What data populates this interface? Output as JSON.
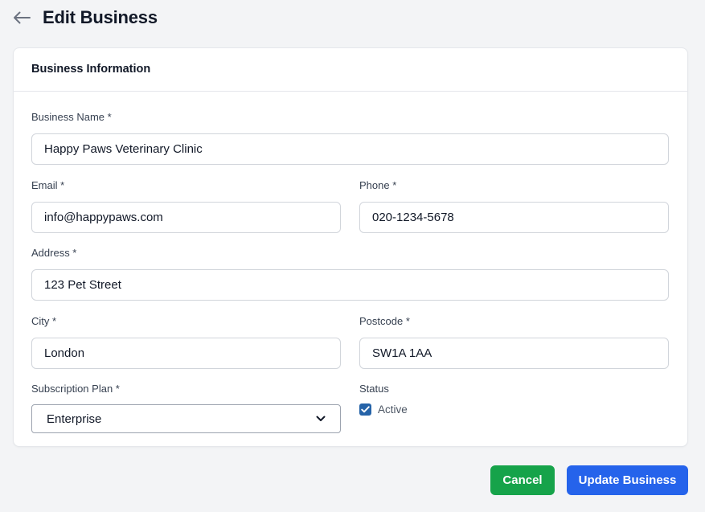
{
  "header": {
    "back_icon": "arrow-left-icon",
    "title": "Edit Business"
  },
  "card": {
    "title": "Business Information"
  },
  "form": {
    "business_name": {
      "label": "Business Name *",
      "value": "Happy Paws Veterinary Clinic"
    },
    "email": {
      "label": "Email *",
      "value": "info@happypaws.com"
    },
    "phone": {
      "label": "Phone *",
      "value": "020-1234-5678"
    },
    "address": {
      "label": "Address *",
      "value": "123 Pet Street"
    },
    "city": {
      "label": "City *",
      "value": "London"
    },
    "postcode": {
      "label": "Postcode *",
      "value": "SW1A 1AA"
    },
    "subscription_plan": {
      "label": "Subscription Plan *",
      "selected": "Enterprise"
    },
    "status": {
      "label": "Status",
      "checkbox_label": "Active",
      "checked": true
    }
  },
  "actions": {
    "cancel_label": "Cancel",
    "update_label": "Update Business"
  },
  "colors": {
    "cancel": "#16a34a",
    "update": "#2563eb",
    "checkbox": "#2563a8",
    "background": "#f3f4f6"
  }
}
